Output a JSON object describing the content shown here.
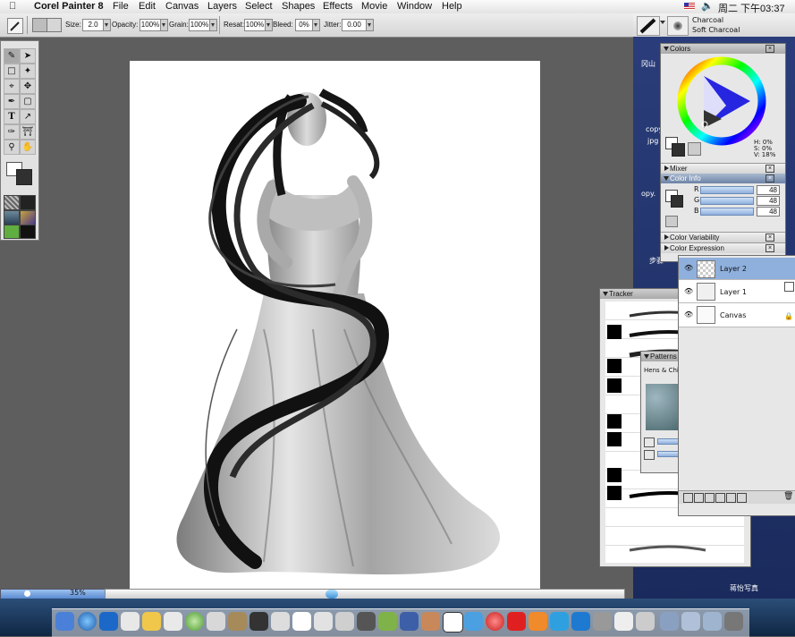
{
  "menubar": {
    "app_name": "Corel Painter 8",
    "items": [
      "File",
      "Edit",
      "Canvas",
      "Layers",
      "Select",
      "Shapes",
      "Effects",
      "Movie",
      "Window",
      "Help"
    ],
    "clock": "周二 下午03:37"
  },
  "property_bar": {
    "size_label": "Size:",
    "size_value": "2.0",
    "opacity_label": "Opacity:",
    "opacity_value": "100%",
    "grain_label": "Grain:",
    "grain_value": "100%",
    "resat_label": "Resat:",
    "resat_value": "100%",
    "bleed_label": "Bleed:",
    "bleed_value": "0%",
    "jitter_label": "Jitter:",
    "jitter_value": "0.00"
  },
  "brush_selector": {
    "category": "Charcoal",
    "variant": "Soft Charcoal"
  },
  "colors_panel": {
    "title": "Colors",
    "h": "H: 0%",
    "s": "S: 0%",
    "v": "V: 18%"
  },
  "mixer_panel": {
    "title": "Mixer"
  },
  "color_info_panel": {
    "title": "Color Info",
    "r_label": "R",
    "r_value": "48",
    "g_label": "G",
    "g_value": "48",
    "b_label": "B",
    "b_value": "48"
  },
  "color_variability_panel": {
    "title": "Color Variability"
  },
  "color_expression_panel": {
    "title": "Color Expression"
  },
  "layers_panel": {
    "layers": [
      {
        "name": "Layer 2",
        "selected": true
      },
      {
        "name": "Layer 1",
        "selected": false
      },
      {
        "name": "Canvas",
        "selected": false
      }
    ]
  },
  "tracker_panel": {
    "title": "Tracker"
  },
  "patterns_panel": {
    "title": "Patterns",
    "pattern_name": "Hens & Chi"
  },
  "desktop": {
    "label_1": "冈山",
    "label_2": "copy",
    "label_3": "jpg",
    "label_4": "opy.",
    "label_5": "步骤",
    "bottom_label": "蒋怡写真"
  },
  "zoom": {
    "value": "35%"
  },
  "colors": {
    "menubar": "#e8e8e8",
    "workspace": "#5e5e5e",
    "selection": "#8fb0dc",
    "current_color": "#303030"
  }
}
